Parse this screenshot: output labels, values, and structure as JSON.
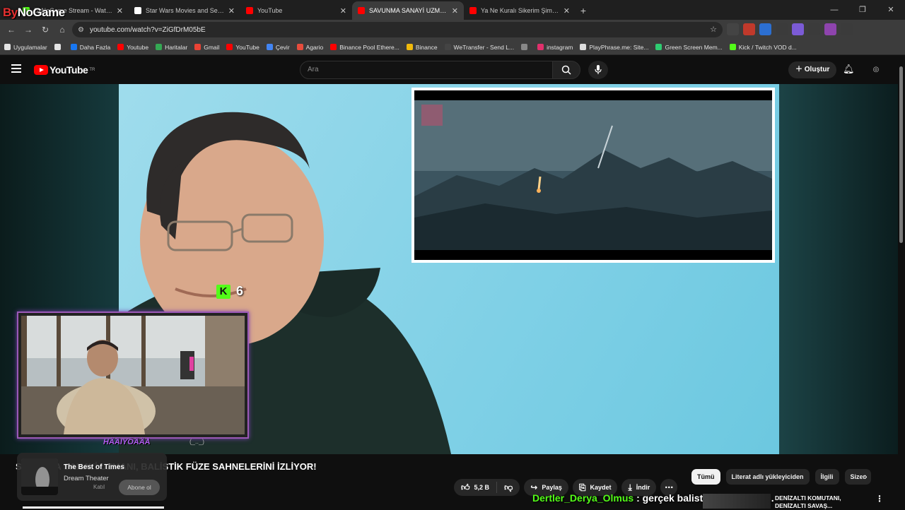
{
  "overlay": {
    "logo_prefix": "By",
    "logo_suffix": "NoGame",
    "kick_count": "6",
    "webcam_name": "HÄÄIYÖÄÄÅ",
    "webcam_tag": "(_.._)",
    "chat_user": "Dertler_Derya_Olmus",
    "chat_message": " : gerçek balistik füze benim..."
  },
  "browser": {
    "tabs": [
      {
        "title": "ByNoGame Stream - Watch Live",
        "close": "✕",
        "color": "#53fc18",
        "active": false
      },
      {
        "title": "Star Wars Movies and Series Vi...",
        "close": "✕",
        "color": "#ffffff",
        "active": false
      },
      {
        "title": "YouTube",
        "close": "✕",
        "color": "#ff0000",
        "active": false
      },
      {
        "title": "SAVUNMA SANAYİ UZMANI",
        "close": "✕",
        "color": "#ff0000",
        "active": true
      },
      {
        "title": "Ya Ne Kuralı Sikerim Şimdi Kura...",
        "close": "✕",
        "color": "#ff0000",
        "active": false
      }
    ],
    "new_tab": "+",
    "window_controls": {
      "minimize": "—",
      "restore": "❐",
      "close": "✕"
    },
    "url": "youtube.com/watch?v=ZiGfDrM05bE",
    "nav": {
      "back": "←",
      "forward": "→",
      "reload": "↻",
      "home": "⌂"
    },
    "extensions": [
      {
        "label": "",
        "color": "#444"
      },
      {
        "label": "",
        "color": "#c0392b"
      },
      {
        "label": "",
        "color": "#2c6fd1"
      },
      {
        "label": "",
        "color": "#3b3b3b"
      },
      {
        "label": "",
        "color": "#7b5bd6"
      },
      {
        "label": "",
        "color": "#3b3b3b"
      },
      {
        "label": "",
        "color": "#8e44ad"
      },
      {
        "label": "",
        "color": "#3b3b3b"
      }
    ],
    "bookmarks": [
      {
        "label": "Uygulamalar",
        "color": "#e3e3e3"
      },
      {
        "label": "",
        "color": "#e3e3e3"
      },
      {
        "label": "Daha Fazla",
        "color": "#1877f2"
      },
      {
        "label": "Youtube",
        "color": "#ff0000"
      },
      {
        "label": "Haritalar",
        "color": "#34a853"
      },
      {
        "label": "Gmail",
        "color": "#ea4335"
      },
      {
        "label": "YouTube",
        "color": "#ff0000"
      },
      {
        "label": "Çevir",
        "color": "#4285f4"
      },
      {
        "label": "Agario",
        "color": "#e74c3c"
      },
      {
        "label": "Binance Pool Ethere...",
        "color": "#ff0000"
      },
      {
        "label": "Binance",
        "color": "#f0b90b"
      },
      {
        "label": "WeTransfer - Send L...",
        "color": "#444444"
      },
      {
        "label": "",
        "color": "#888888"
      },
      {
        "label": "instagram",
        "color": "#e1306c"
      },
      {
        "label": "PlayPhrase.me: Site...",
        "color": "#dddddd"
      },
      {
        "label": "Green Screen Mem...",
        "color": "#2ecc71"
      },
      {
        "label": "Kick / Twitch VOD d...",
        "color": "#53fc18"
      }
    ]
  },
  "youtube": {
    "logo_text": "YouTube",
    "logo_region": "TR",
    "search_placeholder": "Ara",
    "create_label": "Oluştur",
    "video_title": "SAVUNMA SANAYİ UZMANI, BALİSTİK FÜZE SAHNELERİNİ İZLİYOR!",
    "miniplayer": {
      "song": "The Best of Times",
      "artist": "Dream Theater",
      "extra": "Katıl",
      "subscribe": "Abone ol"
    },
    "actions": {
      "likes": "5,2 B",
      "share": "Paylaş",
      "save": "Kaydet",
      "download": "İndir"
    },
    "chips": [
      {
        "label": "Tümü",
        "selected": true
      },
      {
        "label": "Literat adlı yükleyiciden",
        "selected": false
      },
      {
        "label": "İlgili",
        "selected": false
      },
      {
        "label": "Sizer",
        "selected": false
      }
    ],
    "suggestion": {
      "title_line1": "DENİZALTI KOMUTANI,",
      "title_line2": "DENİZALTI SAVAŞ..."
    }
  }
}
